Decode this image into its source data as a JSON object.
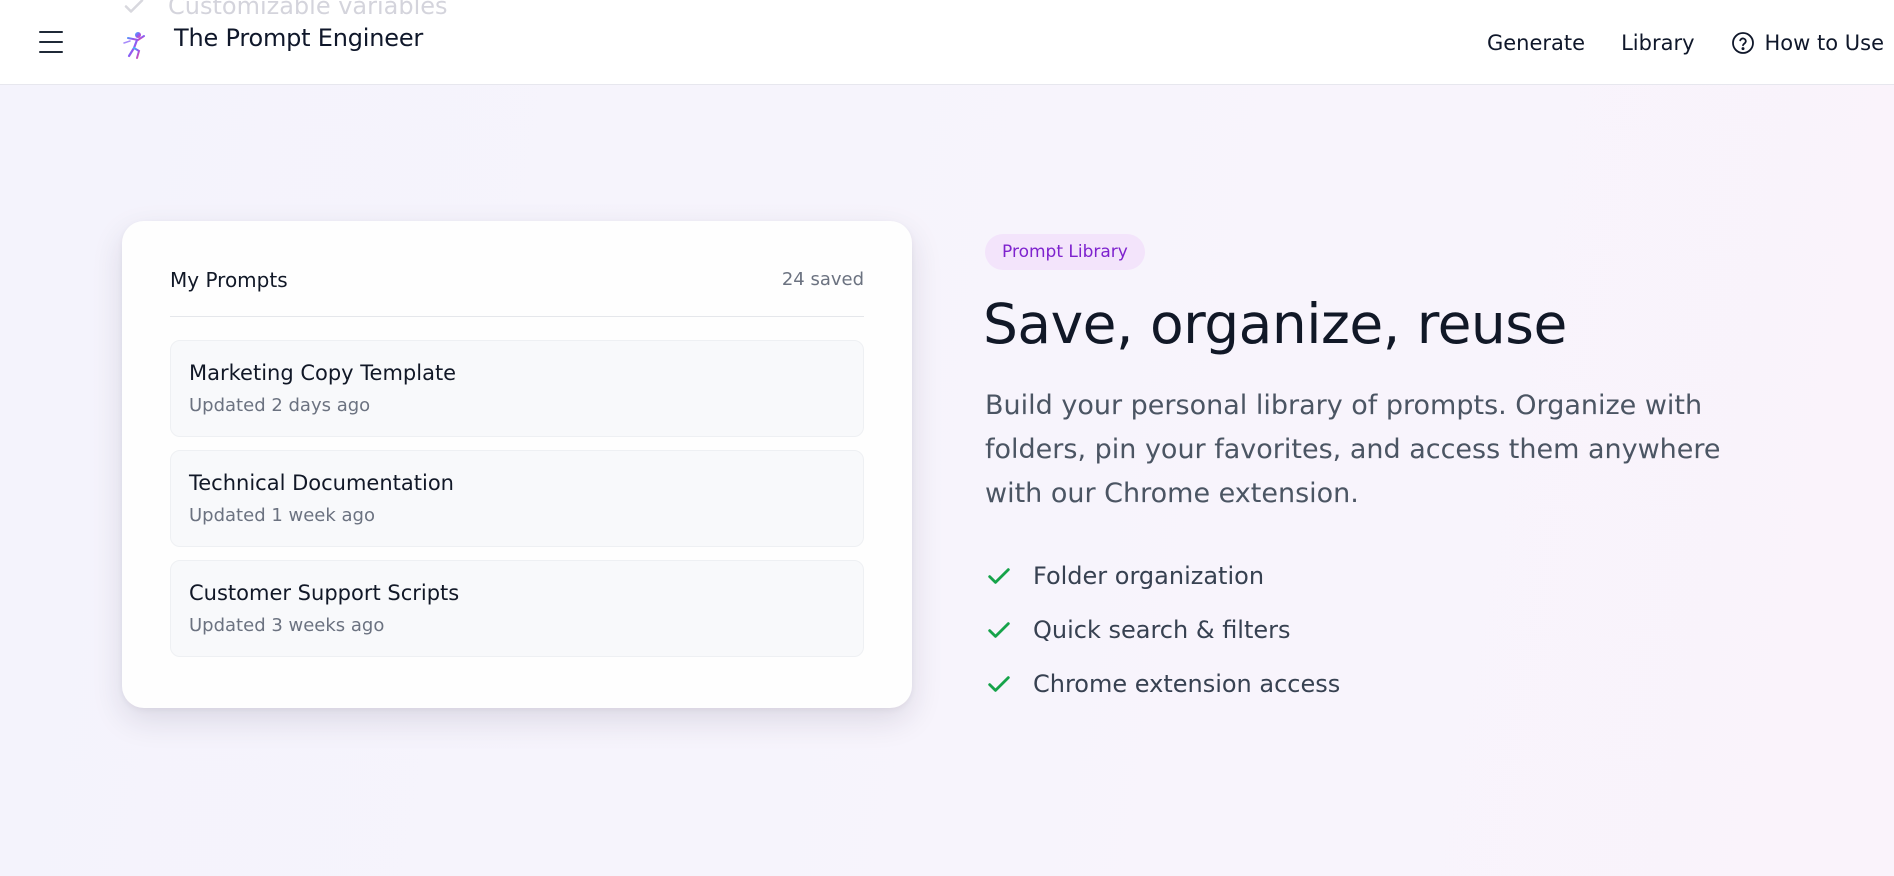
{
  "ghost_text": "Customizable variables",
  "header": {
    "brand": "The Prompt Engineer",
    "nav": [
      {
        "label": "Generate"
      },
      {
        "label": "Library"
      },
      {
        "label": "How to Use",
        "icon": "help-circle-icon"
      }
    ]
  },
  "card": {
    "title": "My Prompts",
    "count": "24 saved",
    "items": [
      {
        "name": "Marketing Copy Template",
        "updated": "Updated 2 days ago"
      },
      {
        "name": "Technical Documentation",
        "updated": "Updated 1 week ago"
      },
      {
        "name": "Customer Support Scripts",
        "updated": "Updated 3 weeks ago"
      }
    ]
  },
  "hero": {
    "badge": "Prompt Library",
    "headline": "Save, organize, reuse",
    "description": "Build your personal library of prompts. Organize with folders, pin your favorites, and access them anywhere with our Chrome extension.",
    "features": [
      {
        "label": "Folder organization"
      },
      {
        "label": "Quick search & filters"
      },
      {
        "label": "Chrome extension access"
      }
    ]
  },
  "colors": {
    "accent_purple": "#7e22ce",
    "badge_bg": "#f3e4fb",
    "check_green": "#16a34a"
  }
}
